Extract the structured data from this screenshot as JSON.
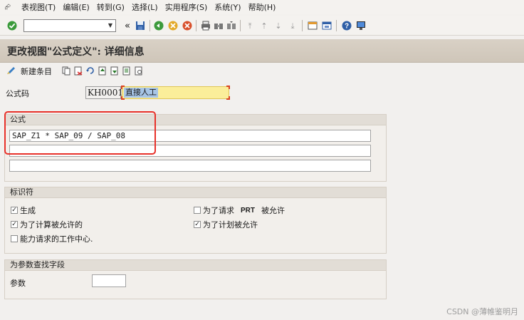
{
  "menu": {
    "items": [
      "表视图(T)",
      "编辑(E)",
      "转到(G)",
      "选择(L)",
      "实用程序(S)",
      "系统(Y)",
      "帮助(H)"
    ]
  },
  "toolbar": {
    "command_value": ""
  },
  "page": {
    "title": "更改视图\"公式定义\": 详细信息"
  },
  "app_toolbar": {
    "new_entries_label": "新建条目"
  },
  "header": {
    "formula_code_label": "公式码",
    "formula_code_value": "KH0001",
    "formula_desc_value": "直接人工"
  },
  "formula_group": {
    "title": "公式",
    "lines": [
      "SAP_Z1 * SAP_09 / SAP_08",
      "",
      ""
    ]
  },
  "identifier_group": {
    "title": "标识符",
    "checkboxes": [
      {
        "label": "生成",
        "checked": true
      },
      {
        "label": "为了计算被允许的",
        "checked": true
      },
      {
        "label": "能力请求的工作中心.",
        "checked": false
      },
      {
        "label_pre": "为了请求",
        "label_bold": "PRT",
        "label_post": "被允许",
        "checked": false
      },
      {
        "label": "为了计划被允许",
        "checked": true
      }
    ]
  },
  "param_group": {
    "title": "为参数查找字段",
    "param_label": "参数",
    "param_value": ""
  },
  "watermark": "CSDN @薄帷鉴明月",
  "colors": {
    "title_bar": "#d3cbbf",
    "required_field": "#fbee9a",
    "highlight_box": "#e8312a"
  }
}
